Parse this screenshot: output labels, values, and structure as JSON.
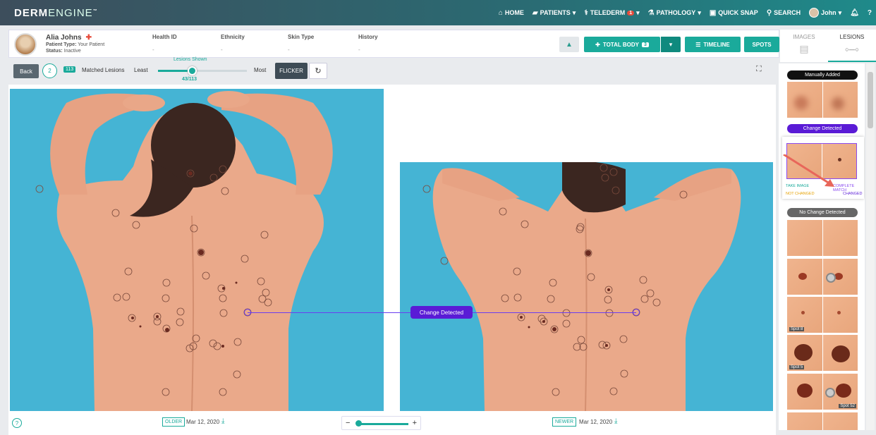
{
  "app": {
    "logo_a": "DERM",
    "logo_b": "ENGINE",
    "tm": "™"
  },
  "nav": {
    "home": "HOME",
    "patients": "PATIENTS",
    "telederm": "TELEDERM",
    "telederm_badge": "1",
    "pathology": "PATHOLOGY",
    "quick_snap": "QUICK SNAP",
    "search": "SEARCH",
    "user": "John",
    "help": "?"
  },
  "patient": {
    "name": "Alia Johns",
    "type_label": "Patient Type:",
    "type_value": "Your Patient",
    "status_label": "Status:",
    "status_value": "Inactive",
    "columns": [
      {
        "label": "Health ID",
        "value": "-"
      },
      {
        "label": "Ethnicity",
        "value": "-"
      },
      {
        "label": "Skin Type",
        "value": "-"
      },
      {
        "label": "History",
        "value": "-"
      }
    ]
  },
  "actions": {
    "total_body": "TOTAL BODY",
    "total_body_count": "3",
    "timeline": "TIMELINE",
    "spots": "SPOTS"
  },
  "right_tabs": {
    "images": "IMAGES",
    "lesions": "LESIONS"
  },
  "toolbar": {
    "back": "Back",
    "circle_count": "2",
    "matched_count": "113",
    "matched_label": "Matched Lesions",
    "least": "Least",
    "most": "Most",
    "lesions_shown_label": "Lesions Shown",
    "lesions_shown": "43/113",
    "lesions_shown_fraction": 0.38,
    "flicker": "FLICKER"
  },
  "comparison": {
    "change_label": "Change Detected",
    "older_tag": "OLDER",
    "older_date": "Mar 12, 2020",
    "newer_tag": "NEWER",
    "newer_date": "Mar 12, 2020"
  },
  "sidebar": {
    "manually_added": "Manually Added",
    "change_detected": "Change Detected",
    "take_image": "TAKE IMAGE",
    "complete_match": "COMPLETE MATCH",
    "not_changed": "NOT CHANGED",
    "changed": "CHANGED",
    "no_change_detected": "No Change Detected",
    "spots": [
      "Spot 8",
      "Spot 5",
      "Spot 52"
    ]
  },
  "colors": {
    "accent": "#1aaa9b",
    "change": "#5a1bd6",
    "backdrop": "#45b4d4",
    "skin": "#eaa98a"
  }
}
